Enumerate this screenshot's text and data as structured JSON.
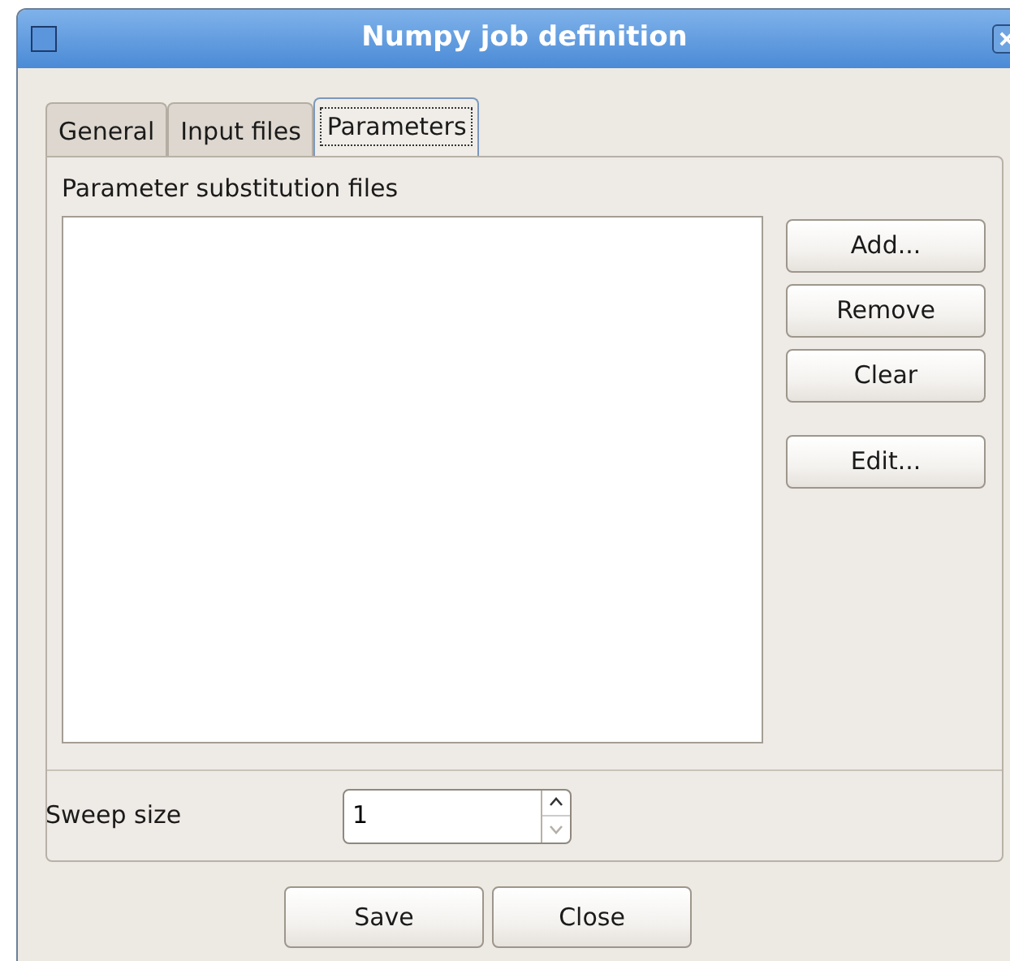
{
  "window": {
    "title": "Numpy job definition"
  },
  "tabs": [
    {
      "label": "General",
      "selected": false
    },
    {
      "label": "Input files",
      "selected": false
    },
    {
      "label": "Parameters",
      "selected": true
    }
  ],
  "parameters": {
    "list_label": "Parameter substitution files",
    "buttons": [
      "Add...",
      "Remove",
      "Clear",
      "Edit..."
    ],
    "sweep_label": "Sweep size",
    "sweep": {
      "value": "1",
      "up_disabled": false,
      "down_disabled": true
    }
  },
  "buttons": [
    "Save",
    "Close"
  ]
}
